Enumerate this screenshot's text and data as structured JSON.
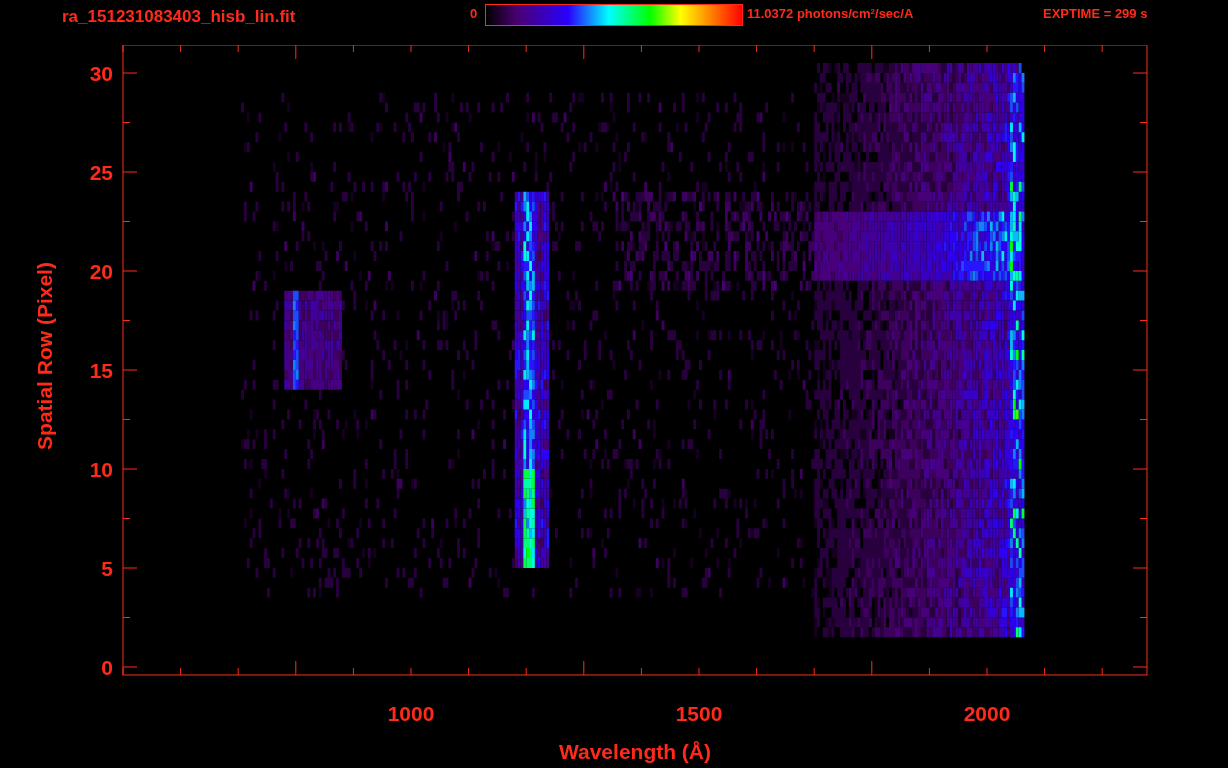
{
  "title": "ra_151231083403_hisb_lin.fit",
  "colorbar": {
    "min_label": "0",
    "max_label": "11.0372 photons/cm$^{2}$/sec/A"
  },
  "exptime": "EXPTIME = 299 s",
  "plot": {
    "xlabel": "Wavelength (Å)",
    "ylabel": "Spatial Row (Pixel)",
    "xtick_labels": [
      "1000",
      "1500",
      "2000"
    ],
    "ytick_labels": [
      "30",
      "25",
      "20",
      "15",
      "10",
      "5",
      "0"
    ]
  }
}
